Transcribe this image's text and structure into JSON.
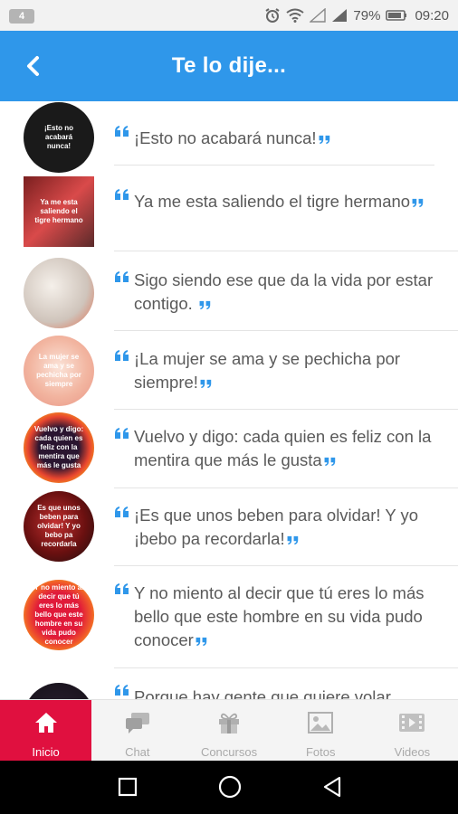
{
  "status_bar": {
    "notification_count": "4",
    "battery": "79%",
    "time": "09:20",
    "icons": [
      "alarm-icon",
      "wifi-icon",
      "signal-icon",
      "battery-icon"
    ]
  },
  "app_bar": {
    "title": "Te lo dije...",
    "back_icon": "chevron-left-icon",
    "color": "#2f97ea"
  },
  "quotes": [
    {
      "text": "¡Esto no acabará nunca!",
      "thumb_text": "¡Esto no acabará nunca!",
      "thumb_bg": "#1a1a1a"
    },
    {
      "text": "Ya me esta saliendo el tigre hermano",
      "thumb_text": "Ya me esta saliendo el tigre hermano",
      "thumb_bg": "#c23a3a"
    },
    {
      "text": "Sigo siendo ese que da la vida por estar contigo. ",
      "thumb_text": "",
      "thumb_bg": "#e9e2dc"
    },
    {
      "text": "¡La mujer se ama y se pechicha por siempre!",
      "thumb_text": "La mujer se ama y se pechicha por siempre",
      "thumb_bg": "#f2b5a0"
    },
    {
      "text": "Vuelvo y digo: cada quien es feliz con la mentira que más le gusta",
      "thumb_text": "Vuelvo y digo: cada quien es feliz con la mentira que más le gusta",
      "thumb_bg": "#e8452f"
    },
    {
      "text": "¡Es que unos beben para olvidar! Y yo ¡bebo pa recordarla!",
      "thumb_text": "Es que unos beben para olvidar! Y yo bebo pa recordarla",
      "thumb_bg": "#8a1a1a"
    },
    {
      "text": "Y no miento al decir que tú eres lo más bello que este hombre en su vida pudo conocer",
      "thumb_text": "Y no miento al decir que tú eres lo más bello que este hombre en su vida pudo conocer",
      "thumb_bg": "#f0582a"
    },
    {
      "text": "Porque hay gente que quiere volar",
      "thumb_text": "",
      "thumb_bg": "#2a2030"
    }
  ],
  "bottom_nav": [
    {
      "label": "Inicio",
      "icon": "home-icon",
      "active": true
    },
    {
      "label": "Chat",
      "icon": "chat-icon",
      "active": false
    },
    {
      "label": "Concursos",
      "icon": "gift-icon",
      "active": false
    },
    {
      "label": "Fotos",
      "icon": "photo-icon",
      "active": false
    },
    {
      "label": "Videos",
      "icon": "video-icon",
      "active": false
    }
  ],
  "accent_color": "#e0103f"
}
